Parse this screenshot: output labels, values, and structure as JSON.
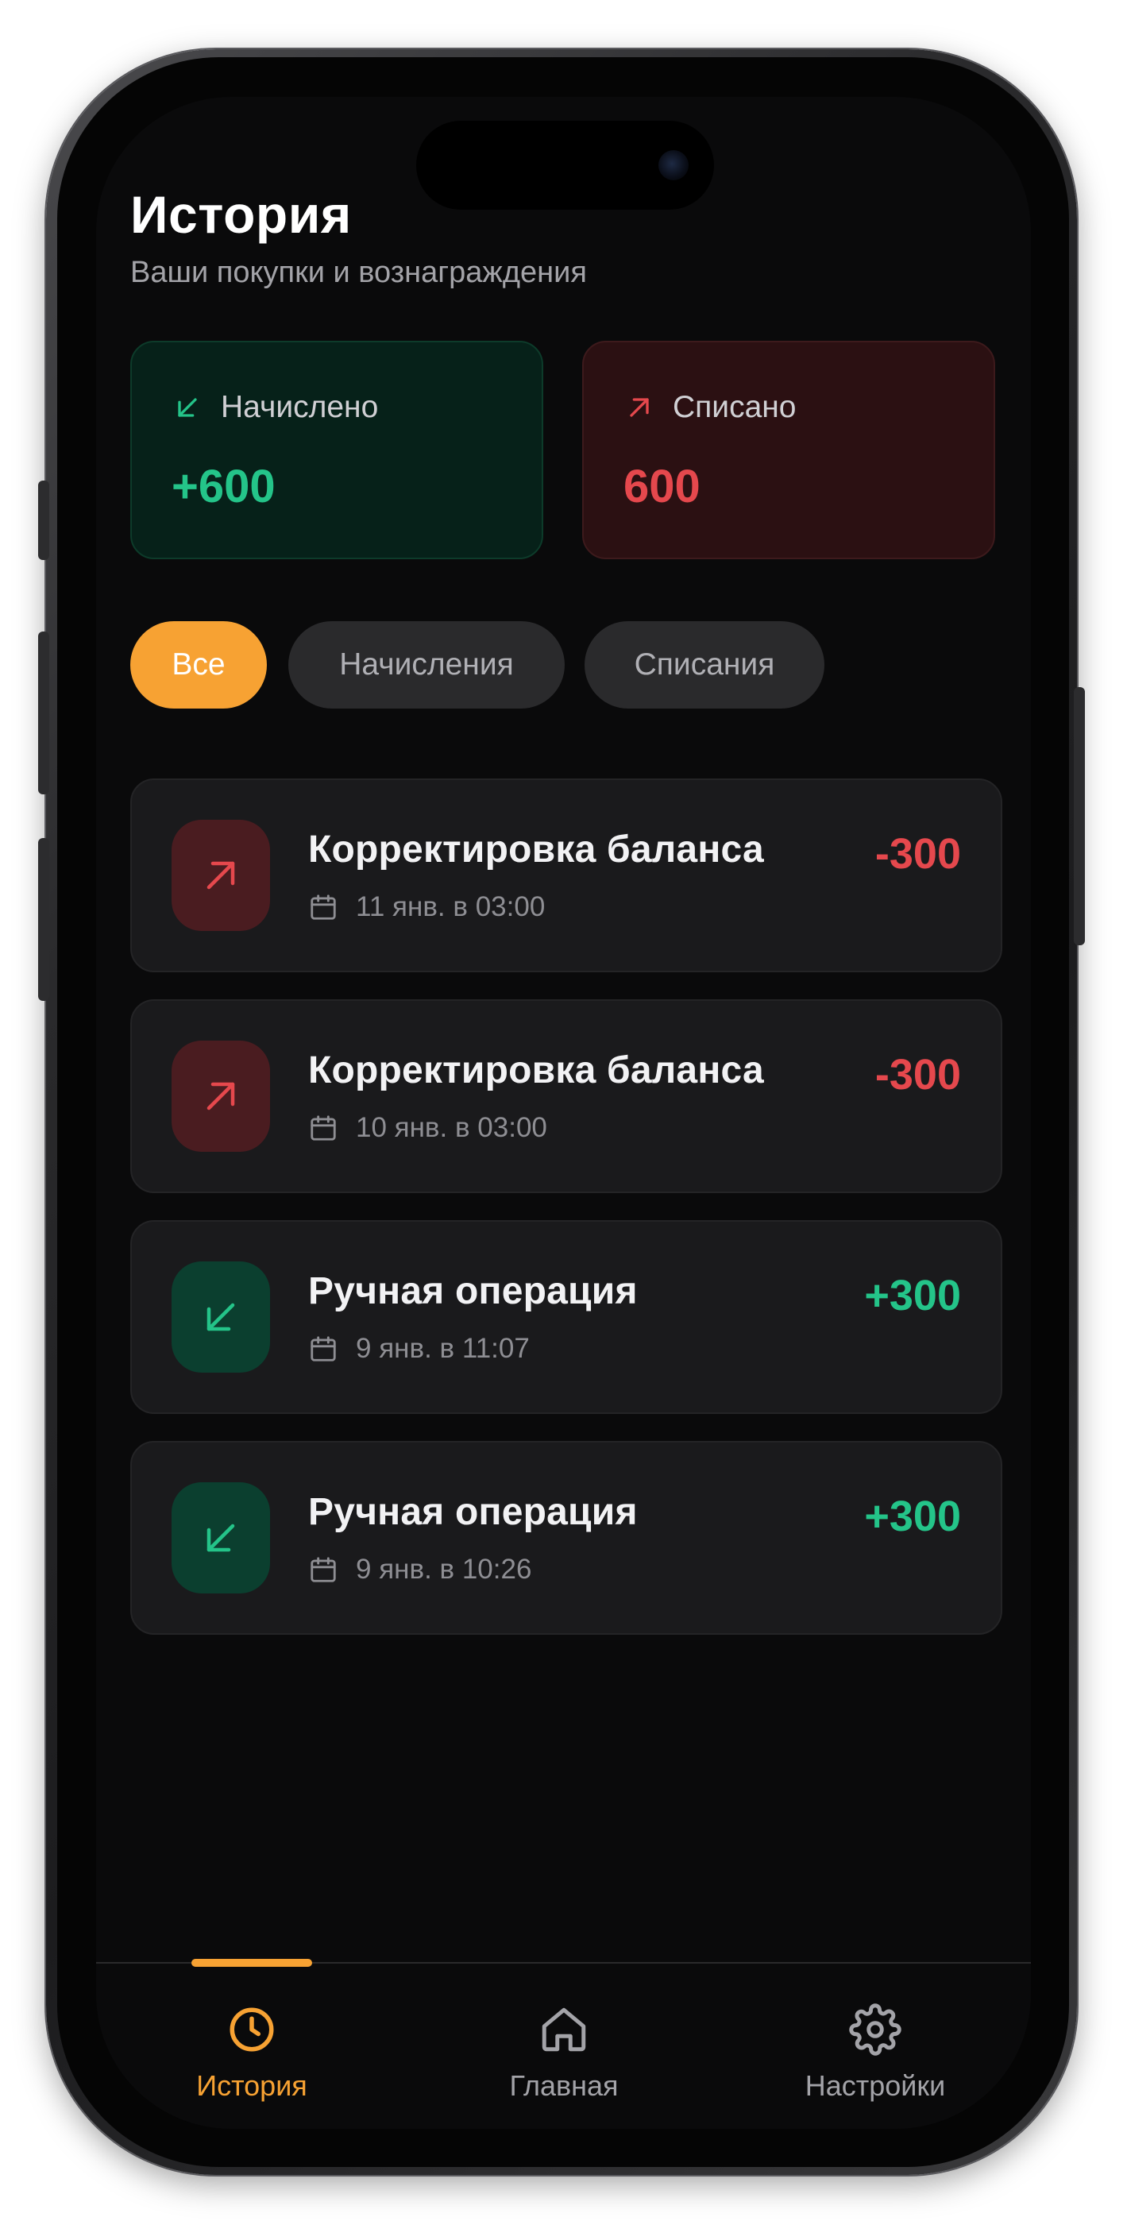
{
  "header": {
    "title": "История",
    "subtitle": "Ваши покупки и вознаграждения"
  },
  "summary": {
    "credited": {
      "label": "Начислено",
      "value": "+600",
      "icon": "arrow-down-left-icon",
      "color": "#24c489"
    },
    "debited": {
      "label": "Списано",
      "value": "600",
      "icon": "arrow-up-right-icon",
      "color": "#e5484d"
    }
  },
  "filters": {
    "all": "Все",
    "credits": "Начисления",
    "debits": "Списания",
    "active": "all"
  },
  "transactions": [
    {
      "title": "Корректировка баланса",
      "date": "11 янв. в 03:00",
      "amount": "-300",
      "type": "debit",
      "icon": "arrow-up-right-icon"
    },
    {
      "title": "Корректировка баланса",
      "date": "10 янв. в 03:00",
      "amount": "-300",
      "type": "debit",
      "icon": "arrow-up-right-icon"
    },
    {
      "title": "Ручная операция",
      "date": "9 янв. в 11:07",
      "amount": "+300",
      "type": "credit",
      "icon": "arrow-down-left-icon"
    },
    {
      "title": "Ручная операция",
      "date": "9 янв. в 10:26",
      "amount": "+300",
      "type": "credit",
      "icon": "arrow-down-left-icon"
    }
  ],
  "tabbar": {
    "history": {
      "label": "История",
      "icon": "clock-icon"
    },
    "home": {
      "label": "Главная",
      "icon": "home-icon"
    },
    "settings": {
      "label": "Настройки",
      "icon": "gear-icon"
    },
    "active": "history"
  },
  "colors": {
    "accent": "#f7a233",
    "credit": "#24c489",
    "debit": "#e5484d",
    "background": "#0a0a0b",
    "card": "#1a1a1c"
  }
}
